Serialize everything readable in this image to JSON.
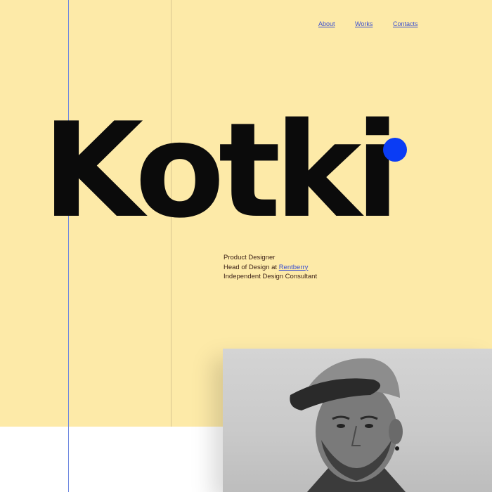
{
  "nav": {
    "about": "About",
    "works": "Works",
    "contacts": "Contacts"
  },
  "logo": {
    "text": "Kotki"
  },
  "bio": {
    "line1": "Product Designer",
    "line2_prefix": "Head of Design at ",
    "line2_link": "Rentberry",
    "line3": "Independent Design Consultant"
  },
  "colors": {
    "hero_background": "#fdeaa8",
    "accent_blue": "#0a3cf5",
    "link_blue": "#3a4fd0",
    "text_dark": "#0b0b0b"
  },
  "photo": {
    "description_icon": "portrait-photo"
  }
}
